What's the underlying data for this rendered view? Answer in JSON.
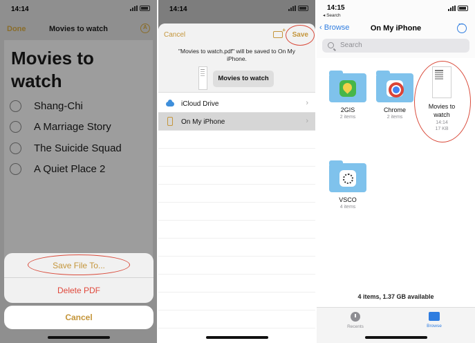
{
  "panel1": {
    "time": "14:14",
    "done_label": "Done",
    "nav_title": "Movies to watch",
    "note_title": "Movies to watch",
    "checklist": [
      "Shang-Chi",
      "A Marriage Story",
      "The Suicide Squad",
      "A Quiet Place 2"
    ],
    "actions": {
      "save": "Save File To...",
      "delete": "Delete PDF"
    },
    "cancel": "Cancel"
  },
  "panel2": {
    "time": "14:14",
    "cancel": "Cancel",
    "save": "Save",
    "message": "\"Movies to watch.pdf\" will be saved to On My iPhone.",
    "file_name": "Movies to watch",
    "locations": [
      {
        "label": "iCloud Drive",
        "icon": "cloud-icon"
      },
      {
        "label": "On My iPhone",
        "icon": "iphone-icon",
        "selected": true
      }
    ]
  },
  "panel3": {
    "time": "14:15",
    "back_app": "◂ Search",
    "back_label": "Browse",
    "title": "On My iPhone",
    "search_placeholder": "Search",
    "items": [
      {
        "name": "2GIS",
        "meta": "2 items",
        "icon": "2gis-icon"
      },
      {
        "name": "Chrome",
        "meta": "2 items",
        "icon": "chrome-icon"
      },
      {
        "name": "Movies to watch",
        "time": "14:14",
        "size": "17 KB",
        "icon": "pdf-document-icon"
      },
      {
        "name": "VSCO",
        "meta": "4 items",
        "icon": "vsco-icon"
      }
    ],
    "footer": "4 items, 1.37 GB available",
    "tabs": [
      {
        "label": "Recents",
        "icon": "clock-icon"
      },
      {
        "label": "Browse",
        "icon": "folder-icon",
        "active": true
      }
    ]
  },
  "colors": {
    "accent_gold": "#c4953a",
    "destructive_red": "#e0483b",
    "ios_blue": "#2f7de0",
    "highlight_oval": "#d94a3a",
    "folder_blue": "#7fc2ec"
  }
}
